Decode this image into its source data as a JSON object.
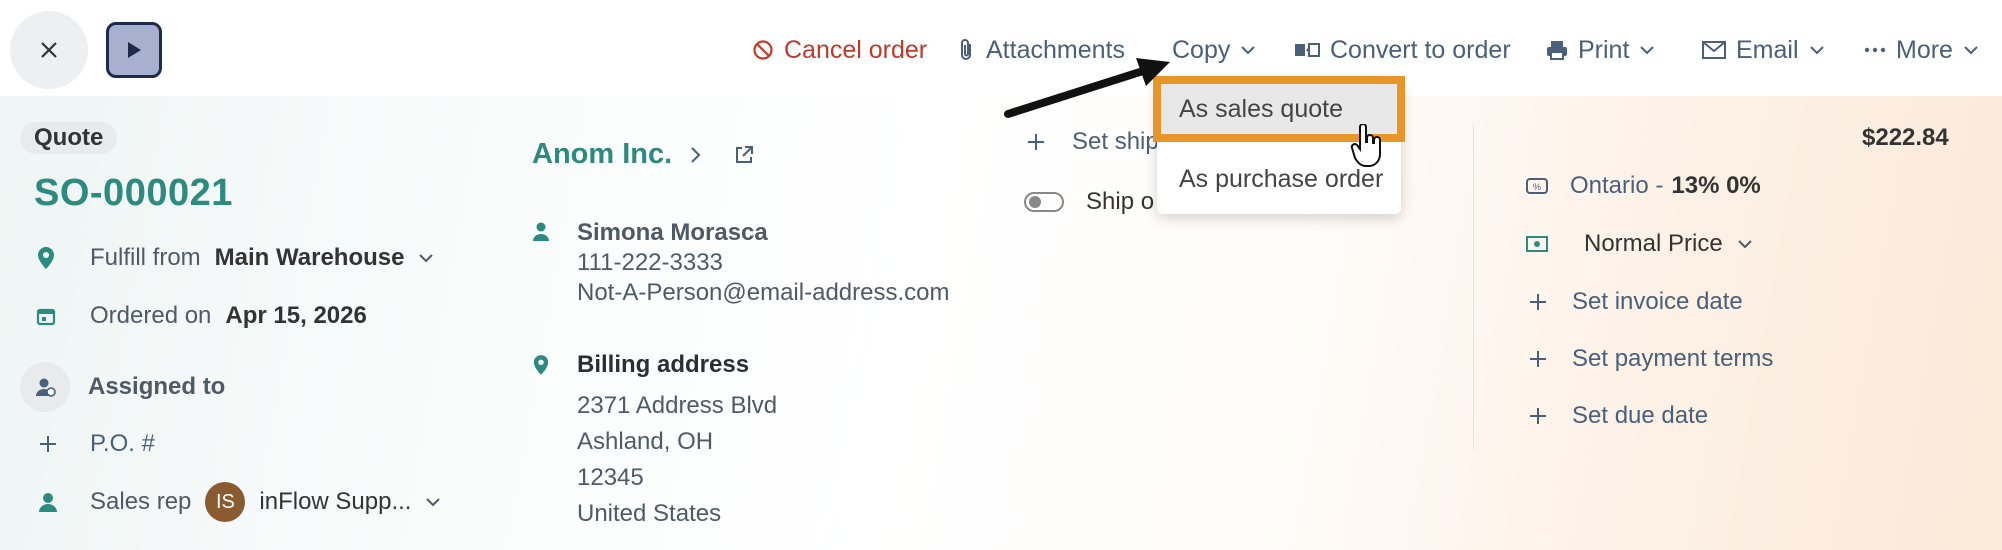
{
  "toolbar": {
    "cancel_label": "Cancel order",
    "attachments_label": "Attachments",
    "copy_label": "Copy",
    "convert_label": "Convert to order",
    "print_label": "Print",
    "email_label": "Email",
    "more_label": "More"
  },
  "copy_menu": {
    "items": [
      {
        "label": "As sales quote"
      },
      {
        "label": "As purchase order"
      }
    ]
  },
  "order": {
    "type_badge": "Quote",
    "number": "SO-000021",
    "fulfill_label": "Fulfill from",
    "fulfill_value": "Main Warehouse",
    "ordered_label": "Ordered on",
    "ordered_value": "Apr 15, 2026",
    "assigned_label": "Assigned to",
    "po_label": "P.O. #",
    "sales_rep_label": "Sales rep",
    "sales_rep_initials": "IS",
    "sales_rep_value": "inFlow Supp..."
  },
  "customer": {
    "name": "Anom Inc.",
    "contact_name": "Simona Morasca",
    "phone": "111-222-3333",
    "email": "Not-A-Person@email-address.com",
    "billing_title": "Billing address",
    "billing_lines": [
      "2371 Address Blvd",
      "Ashland, OH",
      "12345",
      "United States"
    ]
  },
  "shipping": {
    "set_ship_label": "Set ship",
    "ship_toggle_label": "Ship o"
  },
  "totals": {
    "amount": "$222.84",
    "tax_region": "Ontario -",
    "tax_value": "13% 0%",
    "price_level": "Normal Price",
    "invoice_date_label": "Set invoice date",
    "payment_terms_label": "Set payment terms",
    "due_date_label": "Set due date"
  },
  "colors": {
    "accent_teal": "#2c8a7e",
    "cancel_red": "#c0392b",
    "highlight_orange": "#e8962a"
  }
}
